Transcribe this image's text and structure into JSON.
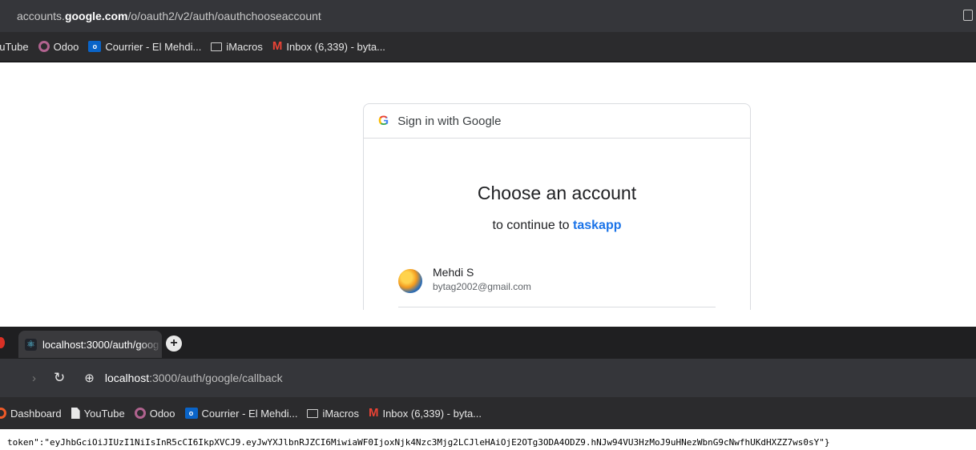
{
  "top_window": {
    "url_prefix": "accounts.",
    "url_domain": "google.com",
    "url_path": "/o/oauth2/v2/auth/oauthchooseaccount",
    "bookmarks": [
      {
        "icon": "odoo-icon",
        "label": "Odoo"
      },
      {
        "icon": "outlook-icon",
        "label": "Courrier - El Mehdi..."
      },
      {
        "icon": "folder-icon",
        "label": "iMacros"
      },
      {
        "icon": "gmail-icon",
        "label": "Inbox (6,339) - byta..."
      }
    ],
    "partial_bookmark": "ouTube"
  },
  "signin": {
    "header_text": "Sign in with Google",
    "logo_letter": "G",
    "title": "Choose an account",
    "continue_prefix": "to continue to ",
    "app_name": "taskapp",
    "account": {
      "name": "Mehdi S",
      "email": "bytag2002@gmail.com"
    }
  },
  "bottom_window": {
    "tab_title": "localhost:3000/auth/goog",
    "new_tab": "+",
    "url_domain": "localhost",
    "url_rest": ":3000/auth/google/callback",
    "bookmarks": [
      {
        "icon": "dashboard-icon",
        "label": "Dashboard"
      },
      {
        "icon": "document-icon",
        "label": "YouTube"
      },
      {
        "icon": "odoo-icon",
        "label": "Odoo"
      },
      {
        "icon": "outlook-icon",
        "label": "Courrier - El Mehdi..."
      },
      {
        "icon": "folder-icon",
        "label": "iMacros"
      },
      {
        "icon": "gmail-icon",
        "label": "Inbox (6,339) - byta..."
      }
    ]
  },
  "page_body": {
    "token_text": "token\":\"eyJhbGciOiJIUzI1NiIsInR5cCI6IkpXVCJ9.eyJwYXJlbnRJZCI6MiwiaWF0IjoxNjk4Nzc3Mjg2LCJleHAiOjE2OTg3ODA4ODZ9.hNJw94VU3HzMoJ9uHNezWbnG9cNwfhUKdHXZZ7ws0sY\"}"
  },
  "colors": {
    "google_blue": "#1a73e8",
    "chrome_dark": "#35363a",
    "bookmark_bar": "#2b2b2d"
  }
}
